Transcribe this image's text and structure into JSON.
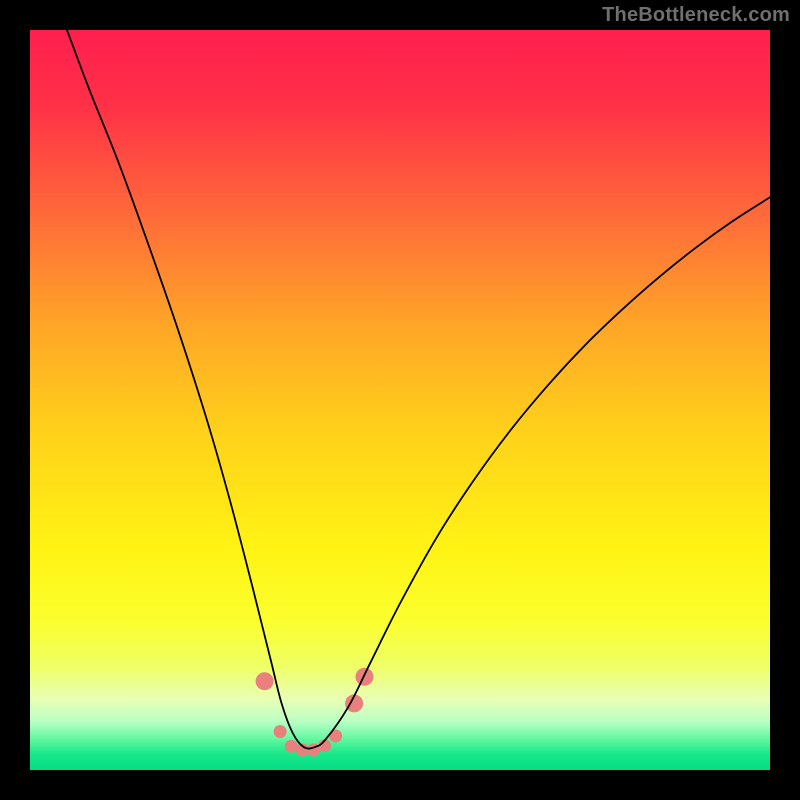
{
  "watermark": {
    "text": "TheBottleneck.com"
  },
  "chart_data": {
    "type": "line",
    "title": "",
    "xlabel": "",
    "ylabel": "",
    "x_range": [
      0,
      100
    ],
    "y_range": [
      0,
      100
    ],
    "grid": false,
    "gradient_stops": [
      {
        "offset": 0.0,
        "color": "#ff1f4f"
      },
      {
        "offset": 0.1,
        "color": "#ff3047"
      },
      {
        "offset": 0.25,
        "color": "#ff6a3a"
      },
      {
        "offset": 0.4,
        "color": "#ffa627"
      },
      {
        "offset": 0.55,
        "color": "#ffd31a"
      },
      {
        "offset": 0.7,
        "color": "#fff314"
      },
      {
        "offset": 0.8,
        "color": "#fbff2e"
      },
      {
        "offset": 0.86,
        "color": "#efff67"
      },
      {
        "offset": 0.905,
        "color": "#e8ffb6"
      },
      {
        "offset": 0.935,
        "color": "#b8ffc4"
      },
      {
        "offset": 0.958,
        "color": "#63f7a0"
      },
      {
        "offset": 0.978,
        "color": "#19e88b"
      },
      {
        "offset": 1.0,
        "color": "#06dd85"
      }
    ],
    "series": [
      {
        "name": "bottleneck-curve",
        "color": "#000000",
        "width": 1.8,
        "x": [
          5,
          8,
          12,
          16,
          20,
          24,
          27,
          30,
          32.5,
          34,
          35.5,
          37,
          38.5,
          40,
          43,
          46,
          50,
          55,
          60,
          65,
          70,
          75,
          80,
          85,
          90,
          95,
          100
        ],
        "y": [
          100,
          92,
          82,
          71,
          59.5,
          47,
          36.5,
          25,
          15,
          9,
          5,
          3.1,
          3.1,
          4.2,
          8.5,
          14.5,
          22.5,
          31.5,
          39.2,
          46,
          52,
          57.4,
          62.2,
          66.6,
          70.6,
          74.2,
          77.4
        ]
      }
    ],
    "markers": {
      "name": "highlight-dots",
      "color": "#e9807d",
      "radius_primary": 9,
      "radius_secondary": 6.5,
      "points": [
        {
          "x": 31.7,
          "y": 12.0,
          "r": "primary"
        },
        {
          "x": 33.8,
          "y": 5.2,
          "r": "secondary"
        },
        {
          "x": 35.3,
          "y": 3.2,
          "r": "secondary"
        },
        {
          "x": 36.8,
          "y": 2.7,
          "r": "secondary"
        },
        {
          "x": 38.3,
          "y": 2.7,
          "r": "secondary"
        },
        {
          "x": 39.8,
          "y": 3.3,
          "r": "secondary"
        },
        {
          "x": 41.3,
          "y": 4.6,
          "r": "secondary"
        },
        {
          "x": 43.8,
          "y": 9.0,
          "r": "primary"
        },
        {
          "x": 45.2,
          "y": 12.6,
          "r": "primary"
        }
      ]
    }
  }
}
